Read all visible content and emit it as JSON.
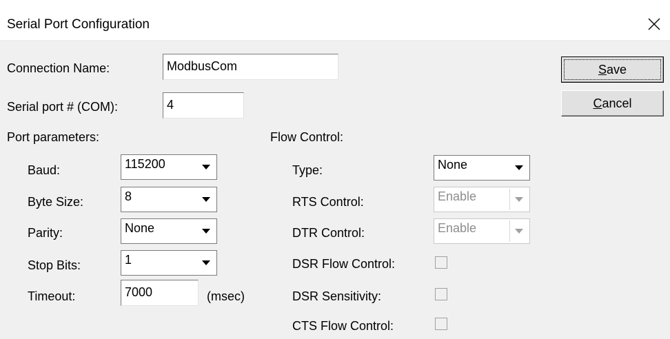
{
  "window": {
    "title": "Serial Port Configuration",
    "close_icon": "close-icon"
  },
  "connection": {
    "name_label": "Connection Name:",
    "name_value": "ModbusCom",
    "port_label": "Serial port # (COM):",
    "port_value": "4"
  },
  "buttons": {
    "save_mnemonic": "S",
    "save_rest": "ave",
    "cancel_mnemonic": "C",
    "cancel_rest": "ancel"
  },
  "port_parameters": {
    "heading": "Port parameters:",
    "baud_label": "Baud:",
    "baud_value": "115200",
    "byte_size_label": "Byte Size:",
    "byte_size_value": "8",
    "parity_label": "Parity:",
    "parity_value": "None",
    "stop_bits_label": "Stop Bits:",
    "stop_bits_value": "1",
    "timeout_label": "Timeout:",
    "timeout_value": "7000",
    "timeout_unit": "(msec)"
  },
  "flow_control": {
    "heading": "Flow Control:",
    "type_label": "Type:",
    "type_value": "None",
    "rts_label": "RTS Control:",
    "rts_value": "Enable",
    "dtr_label": "DTR Control:",
    "dtr_value": "Enable",
    "dsr_flow_label": "DSR Flow Control:",
    "dsr_flow_checked": false,
    "dsr_sens_label": "DSR Sensitivity:",
    "dsr_sens_checked": false,
    "cts_flow_label": "CTS Flow Control:",
    "cts_flow_checked": false
  },
  "colors": {
    "client_bg": "#f0f0f0",
    "disabled_text": "#8d8d8d"
  }
}
